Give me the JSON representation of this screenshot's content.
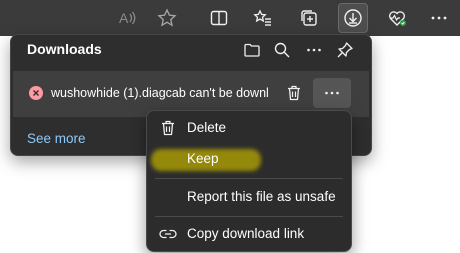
{
  "toolbar": {
    "buttons": [
      {
        "name": "read-aloud",
        "icon": "read-aloud-icon"
      },
      {
        "name": "favorite",
        "icon": "star-icon"
      },
      {
        "name": "split-screen",
        "icon": "split-screen-icon"
      },
      {
        "name": "favorites",
        "icon": "favorites-list-icon"
      },
      {
        "name": "collections",
        "icon": "collections-icon"
      },
      {
        "name": "downloads",
        "icon": "download-icon",
        "active": true
      },
      {
        "name": "browser-essentials",
        "icon": "heart-pulse-icon"
      },
      {
        "name": "settings-and-more",
        "icon": "more-icon"
      }
    ]
  },
  "downloads": {
    "title": "Downloads",
    "file_text": "wushowhide (1).diagcab can't be downl",
    "see_more": "See more"
  },
  "context_menu": {
    "delete": "Delete",
    "keep": "Keep",
    "report": "Report this file as unsafe",
    "copy_link": "Copy download link"
  },
  "colors": {
    "toolbar_bg": "#3b3b3b",
    "panel_bg": "#2e2e2e",
    "link": "#8fc8f8",
    "error": "#ff99a4",
    "highlight": "#b8a800"
  }
}
